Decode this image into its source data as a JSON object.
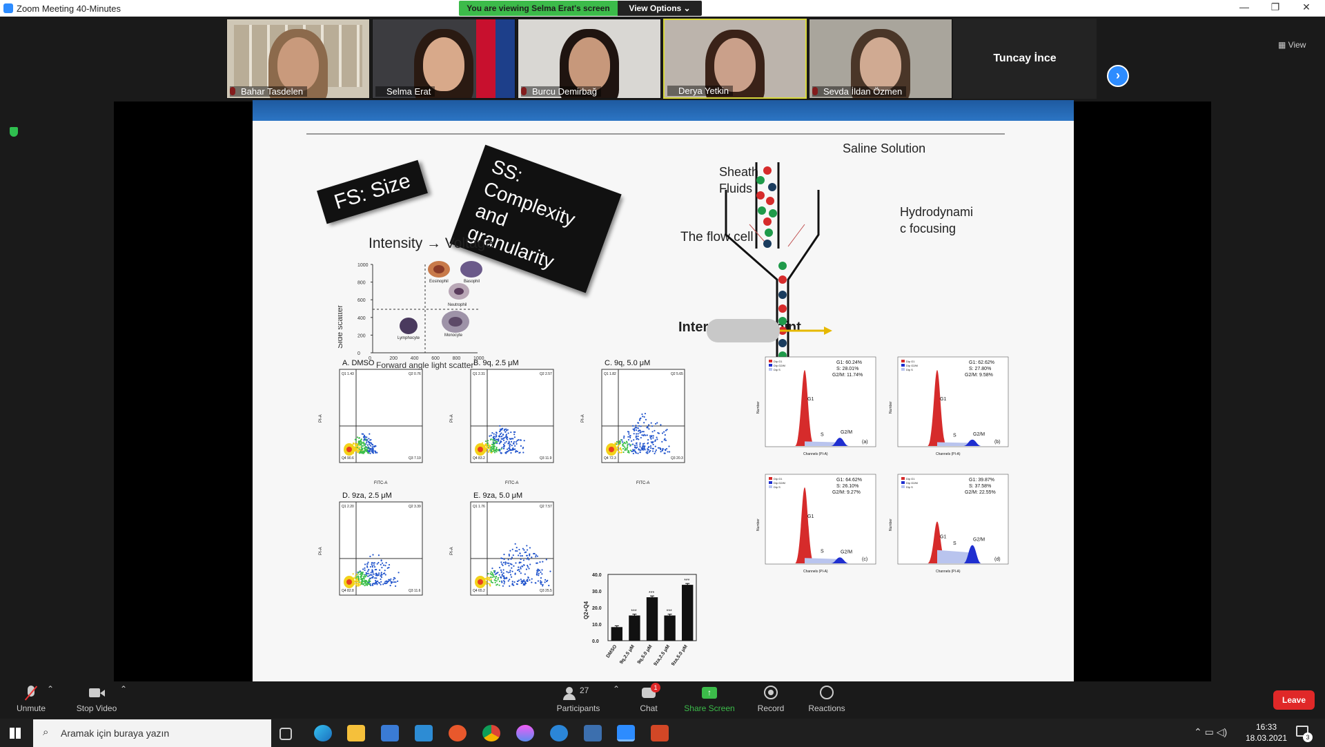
{
  "window": {
    "title": "Zoom Meeting 40-Minutes",
    "minimize": "—",
    "restore": "❐",
    "close": "✕"
  },
  "share_banner": {
    "text": "You are viewing Selma Erat's screen",
    "view_options": "View Options ⌄"
  },
  "participants_strip": [
    {
      "name": "Bahar Tasdelen",
      "muted": true
    },
    {
      "name": "Selma Erat",
      "muted": false
    },
    {
      "name": "Burcu Demirbağ",
      "muted": true
    },
    {
      "name": "Derya Yetkin",
      "muted": false
    },
    {
      "name": "Sevda İldan Özmen",
      "muted": true
    }
  ],
  "name_only_tile": {
    "name": "Tuncay İnce"
  },
  "next_page_icon": "chevron-right-icon",
  "view_button": "View",
  "slide": {
    "tag_fs": "FS: Size",
    "tag_ss_line1": "SS: Complexity",
    "tag_ss_line2": "and granularity",
    "intensity": "Intensity → Voltage",
    "saline": "Saline Solution",
    "sheath_line1": "Sheath",
    "sheath_line2": "Fluids",
    "flow_cell": "The flow cell",
    "hydro_line1": "Hydrodynami",
    "hydro_line2": "c focusing",
    "interrogation": "Interrogation point",
    "scatter_ylabel": "Side scatter",
    "scatter_xlabel": "Forward angle light scatter",
    "scatter_ticks_y": [
      "1000",
      "800",
      "600",
      "400",
      "200",
      "0"
    ],
    "scatter_ticks_x": [
      "0",
      "200",
      "400",
      "600",
      "800",
      "1000"
    ],
    "cells": [
      "Eosinophil",
      "Basophil",
      "Neutrophil",
      "Lymphocyte",
      "Monocyte"
    ],
    "flow_panels": [
      {
        "title": "A. DMSO",
        "q1": "Q1 1.43",
        "q2": "Q2 0.76",
        "q3": "Q3 7.19",
        "q4": "Q4 90.6"
      },
      {
        "title": "B. 9q, 2.5 μM",
        "q1": "Q1 2.31",
        "q2": "Q2 2.57",
        "q3": "Q3 11.9",
        "q4": "Q4 83.2"
      },
      {
        "title": "C. 9q, 5.0 μM",
        "q1": "Q1 1.82",
        "q2": "Q2 5.65",
        "q3": "Q3 20.3",
        "q4": "Q4 72.3"
      },
      {
        "title": "D. 9za, 2.5 μM",
        "q1": "Q1 2.20",
        "q2": "Q2 3.39",
        "q3": "Q3 11.6",
        "q4": "Q4 82.8"
      },
      {
        "title": "E. 9za, 5.0 μM",
        "q1": "Q1 1.76",
        "q2": "Q2 7.57",
        "q3": "Q3 25.5",
        "q4": "Q4 65.2"
      }
    ],
    "flow_axis_x": "FITC-A",
    "flow_axis_y": "PI-A",
    "histograms": [
      {
        "g1": "G1: 60.24%",
        "s": "S: 28.01%",
        "g2m": "G2/M: 11.74%",
        "tag": "(a)"
      },
      {
        "g1": "G1: 62.62%",
        "s": "S: 27.80%",
        "g2m": "G2/M: 9.58%",
        "tag": "(b)"
      },
      {
        "g1": "G1: 64.62%",
        "s": "S: 26.10%",
        "g2m": "G2/M: 9.27%",
        "tag": "(c)"
      },
      {
        "g1": "G1: 39.87%",
        "s": "S: 37.58%",
        "g2m": "G2/M: 22.55%",
        "tag": "(d)"
      }
    ],
    "hist_xlabel": "Channels (PI-A)",
    "hist_ylabel": "Number",
    "hist_legend": [
      "Dip G1",
      "Dip G2/M",
      "Dip S"
    ],
    "peak_labels": [
      "G1",
      "S",
      "G2/M"
    ]
  },
  "chart_data": {
    "type": "bar",
    "categories": [
      "DMSO",
      "9q,2.5 μM",
      "9q,5.0 μM",
      "9za,2.5 μM",
      "9za,5.0 μM"
    ],
    "values": [
      8,
      15,
      26,
      15,
      33.5
    ],
    "errors": [
      1,
      1,
      1,
      1,
      1
    ],
    "significance": [
      "",
      "***",
      "***",
      "***",
      "***"
    ],
    "ylabel": "Q2+Q4",
    "ylim": [
      0,
      40
    ],
    "yticks": [
      "0.0",
      "10.0",
      "20.0",
      "30.0",
      "40.0"
    ]
  },
  "toolbar": {
    "unmute": "Unmute",
    "stop_video": "Stop Video",
    "participants": "Participants",
    "participants_count": "27",
    "chat": "Chat",
    "chat_badge": "1",
    "share_screen": "Share Screen",
    "record": "Record",
    "reactions": "Reactions",
    "leave": "Leave"
  },
  "taskbar": {
    "search_placeholder": "Aramak için buraya yazın",
    "time": "16:33",
    "date": "18.03.2021",
    "notif": "3"
  }
}
